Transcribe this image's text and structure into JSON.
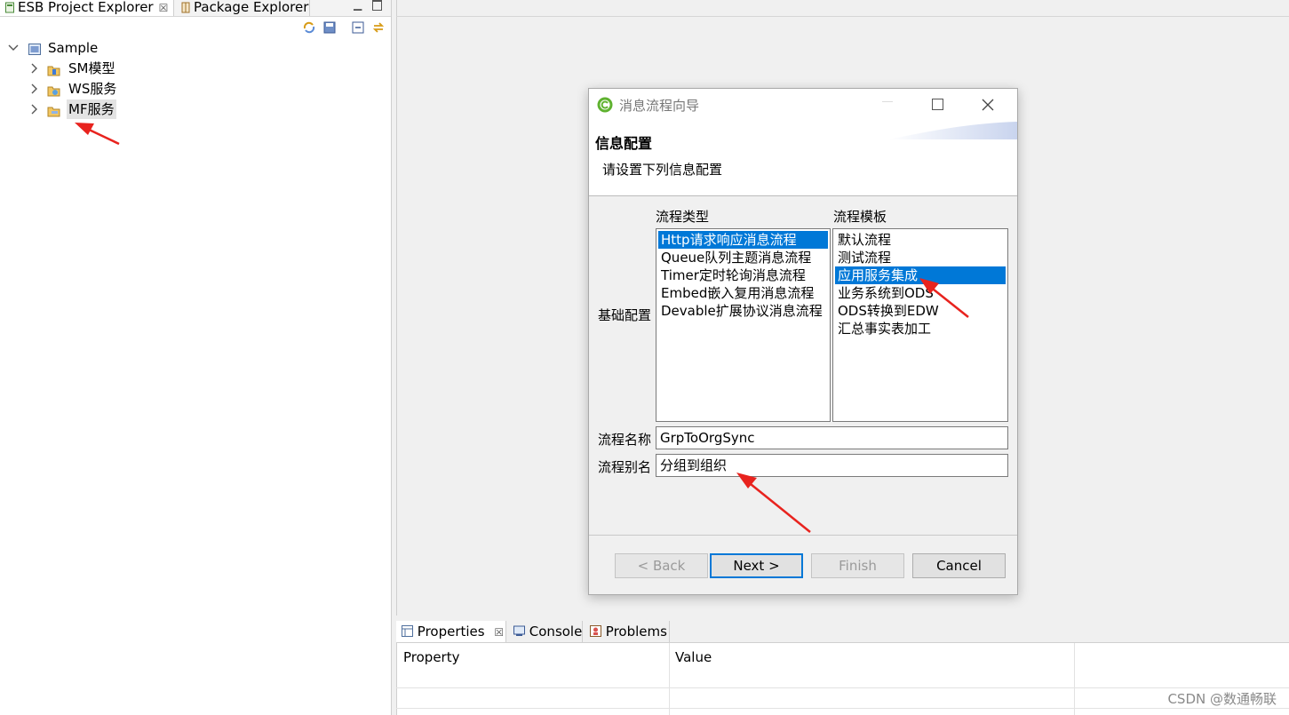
{
  "explorer": {
    "tabs": [
      {
        "label": "ESB Project Explorer",
        "close": "☒"
      },
      {
        "label": "Package Explorer"
      }
    ],
    "tree": {
      "root": {
        "label": "Sample",
        "expanded": true
      },
      "children": [
        {
          "label": "SM模型",
          "icon": "model-folder-icon"
        },
        {
          "label": "WS服务",
          "icon": "service-folder-icon"
        },
        {
          "label": "MF服务",
          "icon": "flow-folder-icon",
          "selected": true
        }
      ]
    }
  },
  "dialog": {
    "title": "消息流程向导",
    "header_title": "信息配置",
    "header_desc": "请设置下列信息配置",
    "section_label": "基础配置",
    "flow_type": {
      "label": "流程类型",
      "items": [
        "Http请求响应消息流程",
        "Queue队列主题消息流程",
        "Timer定时轮询消息流程",
        "Embed嵌入复用消息流程",
        "Devable扩展协议消息流程"
      ],
      "selected_index": 0
    },
    "flow_template": {
      "label": "流程模板",
      "items": [
        "默认流程",
        "测试流程",
        "应用服务集成",
        "业务系统到ODS",
        "ODS转换到EDW",
        "汇总事实表加工"
      ],
      "selected_index": 2
    },
    "flow_name": {
      "label": "流程名称",
      "value": "GrpToOrgSync"
    },
    "flow_alias": {
      "label": "流程别名",
      "value": "分组到组织"
    },
    "buttons": {
      "back": "< Back",
      "next": "Next >",
      "finish": "Finish",
      "cancel": "Cancel"
    }
  },
  "bottom": {
    "tabs": [
      {
        "label": "Properties",
        "close": "☒"
      },
      {
        "label": "Console"
      },
      {
        "label": "Problems"
      }
    ],
    "columns": [
      "Property",
      "Value"
    ]
  },
  "watermark": "CSDN @数通畅联",
  "colors": {
    "selection": "#0078d7",
    "annotation": "#e8231e"
  }
}
